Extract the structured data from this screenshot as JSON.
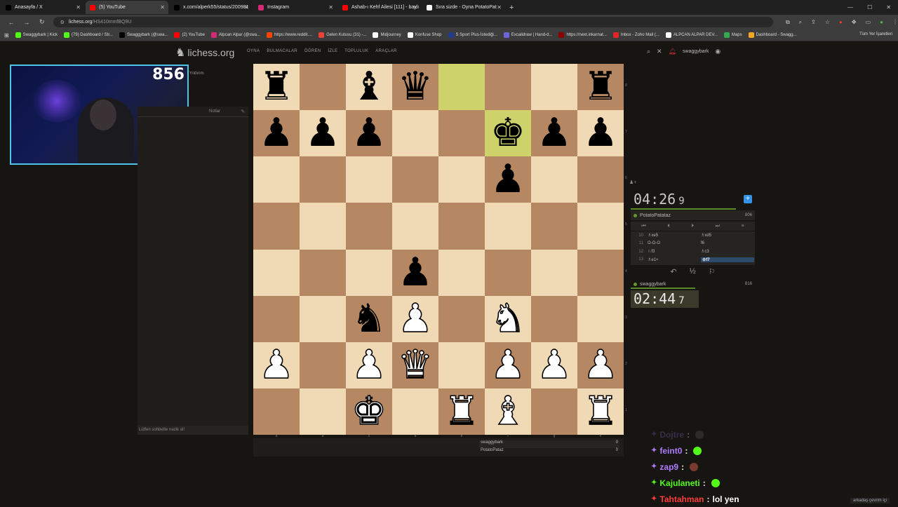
{
  "browser": {
    "tabs": [
      {
        "label": "Anasayfa / X",
        "icon": "x-icon",
        "color": "#000000",
        "active": false
      },
      {
        "label": "(5) YouTube",
        "icon": "youtube-icon",
        "color": "#ff0000",
        "active": true
      },
      {
        "label": "x.com/alperk55/status/200981",
        "icon": "x-icon",
        "color": "#000000",
        "active": false
      },
      {
        "label": "Instagram",
        "icon": "instagram-icon",
        "color": "#d62976",
        "active": false
      },
      {
        "label": "Ashab-ı Kehf Ailesi [111] - baylı",
        "icon": "youtube-icon",
        "color": "#ff0000",
        "active": false
      },
      {
        "label": "Sıra sizde - Oyna PotatoPat",
        "icon": "lichess-icon",
        "color": "#ffffff",
        "active": false
      }
    ],
    "url_host": "lichess.org",
    "url_path": "/HS410mmfBQ9U",
    "bookmarks": [
      {
        "label": "Swaggybark | Kick",
        "color": "#53fc18"
      },
      {
        "label": "(79) Dashboard / Str...",
        "color": "#53fc18"
      },
      {
        "label": "Swaggybark (@swa...",
        "color": "#000000"
      },
      {
        "label": "(2) YouTube",
        "color": "#ff0000"
      },
      {
        "label": "Alpcan Alpar (@swa...",
        "color": "#d62976"
      },
      {
        "label": "https://www.reddit....",
        "color": "#ff4500"
      },
      {
        "label": "Gelen Kutusu (31) -...",
        "color": "#ea4335"
      },
      {
        "label": "Midjourney",
        "color": "#ffffff"
      },
      {
        "label": "Konfuse Shop",
        "color": "#ffffff"
      },
      {
        "label": "S Sport Plus-İstediği...",
        "color": "#1e3a8a"
      },
      {
        "label": "Excalidraw | Hand-d...",
        "color": "#6965db"
      },
      {
        "label": "https://next.inkarnat...",
        "color": "#8b0000"
      },
      {
        "label": "Inbox - Zoho Mail (...",
        "color": "#e42527"
      },
      {
        "label": "ALPCAN ALPAR DEV...",
        "color": "#ffffff"
      },
      {
        "label": "Maps",
        "color": "#34a853"
      },
      {
        "label": "Dashboard - Swagg...",
        "color": "#f5a623"
      }
    ],
    "all_bookmarks": "Tüm Yer İşaretleri"
  },
  "site": {
    "logo": "lichess.org",
    "nav": [
      "OYNA",
      "BULMACALAR",
      "ÖĞREN",
      "İZLE",
      "TOPLULUK",
      "ARAÇLAR"
    ],
    "username": "swaggybark"
  },
  "webcam": {
    "score": "856"
  },
  "left": {
    "mode": "Yıldırım",
    "notes": "Notlar",
    "chat_hint": "Lütfen sohbette nazik ol!"
  },
  "board": {
    "files": [
      "a",
      "b",
      "c",
      "d",
      "e",
      "f",
      "g",
      "h"
    ],
    "ranks": [
      "8",
      "7",
      "6",
      "5",
      "4",
      "3",
      "2",
      "1"
    ],
    "highlight": [
      "e8",
      "f7"
    ],
    "position": [
      [
        "bR",
        "",
        "bB",
        "bQ",
        "",
        "",
        "",
        "bR"
      ],
      [
        "bP",
        "bP",
        "bP",
        "",
        "",
        "bK",
        "bP",
        "bP"
      ],
      [
        "",
        "",
        "",
        "",
        "",
        "bP",
        "",
        ""
      ],
      [
        "",
        "",
        "",
        "",
        "",
        "",
        "",
        ""
      ],
      [
        "",
        "",
        "",
        "bP",
        "",
        "",
        "",
        ""
      ],
      [
        "",
        "",
        "bN",
        "wP",
        "",
        "wN",
        "",
        ""
      ],
      [
        "wP",
        "",
        "wP",
        "wQ",
        "",
        "wP",
        "wP",
        "wP"
      ],
      [
        "",
        "",
        "wK",
        "",
        "wR",
        "wB",
        "",
        "wR"
      ]
    ]
  },
  "below_board": {
    "rows": [
      {
        "name": "swaggybark",
        "score": "0"
      },
      {
        "name": "PotatoPataz",
        "score": "0"
      }
    ]
  },
  "game": {
    "opponent": {
      "name": "PotatoPatataz",
      "rating": "806",
      "clock_main": "04:26",
      "clock_tenth": "9"
    },
    "player": {
      "name": "swaggybark",
      "rating": "816",
      "clock_main": "02:44",
      "clock_tenth": "7"
    },
    "moves": [
      {
        "n": "10",
        "w": "♗xe5",
        "b": "♗xd5",
        "cur": false
      },
      {
        "n": "11",
        "w": "O-O-O",
        "b": "f6",
        "cur": false
      },
      {
        "n": "12",
        "w": "♘f3",
        "b": "♗c3",
        "cur": false
      },
      {
        "n": "13",
        "w": "♗e1+",
        "b": "♔f7",
        "cur": true
      }
    ],
    "half": "½"
  },
  "chat": [
    {
      "user": "Dojtre",
      "msg": "",
      "color": "#6a5fb0",
      "emote": "#555555"
    },
    {
      "user": "feint0",
      "msg": "",
      "color": "#b07cff",
      "emote": "#53fc18"
    },
    {
      "user": "zap9",
      "msg": "",
      "color": "#b07cff",
      "emote": "#7a3b2e"
    },
    {
      "user": "Kajulaneti",
      "msg": "",
      "color": "#53fc18",
      "emote": "#53fc18"
    },
    {
      "user": "Tahtahman",
      "msg": "lol yen",
      "color": "#ff3b3b",
      "emote": ""
    }
  ],
  "friends": "arkadaş çevrim içi"
}
